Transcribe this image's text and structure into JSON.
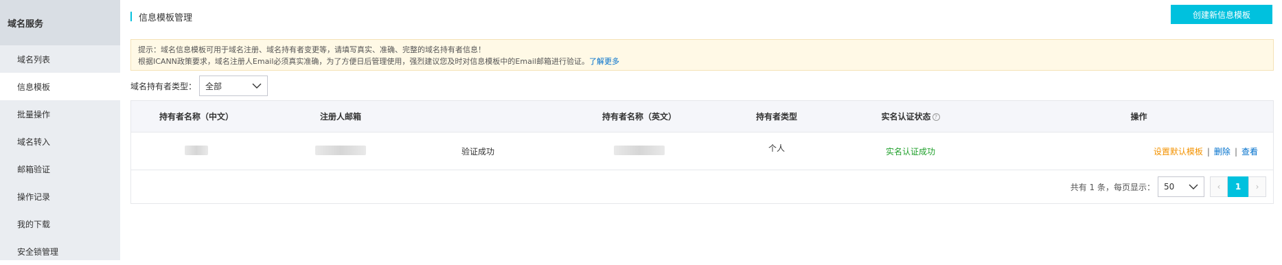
{
  "sidebar": {
    "header": "域名服务",
    "items": [
      {
        "label": "域名列表"
      },
      {
        "label": "信息模板"
      },
      {
        "label": "批量操作"
      },
      {
        "label": "域名转入"
      },
      {
        "label": "邮箱验证"
      },
      {
        "label": "操作记录"
      },
      {
        "label": "我的下载"
      },
      {
        "label": "安全锁管理"
      }
    ]
  },
  "page": {
    "title": "信息模板管理",
    "create_button": "创建新信息模板"
  },
  "notice": {
    "line1": "提示：域名信息模板可用于域名注册、域名持有者变更等，请填写真实、准确、完整的域名持有者信息！",
    "line2": "根据ICANN政策要求，域名注册人Email必须真实准确，为了方便日后管理使用，强烈建议您及时对信息模板中的Email邮箱进行验证。",
    "learn_more": "了解更多"
  },
  "filter": {
    "label": "域名持有者类型：",
    "value": "全部"
  },
  "table": {
    "headers": {
      "name_cn": "持有者名称（中文）",
      "email": "注册人邮箱",
      "name_en": "持有者名称（英文）",
      "type": "持有者类型",
      "realname": "实名认证状态",
      "ops": "操作"
    },
    "rows": [
      {
        "email_status": "验证成功",
        "type": "个人",
        "realname_status": "实名认证成功",
        "op_default": "设置默认模板",
        "op_delete": "删除",
        "op_view": "查看"
      }
    ]
  },
  "pager": {
    "summary": "共有 1 条，每页显示：",
    "page_size": "50",
    "current_page": "1",
    "prev": "‹",
    "next": "›"
  },
  "colors": {
    "accent": "#00c1de",
    "success": "#1e9f2a",
    "warning": "#f39200",
    "link": "#0070cc"
  }
}
